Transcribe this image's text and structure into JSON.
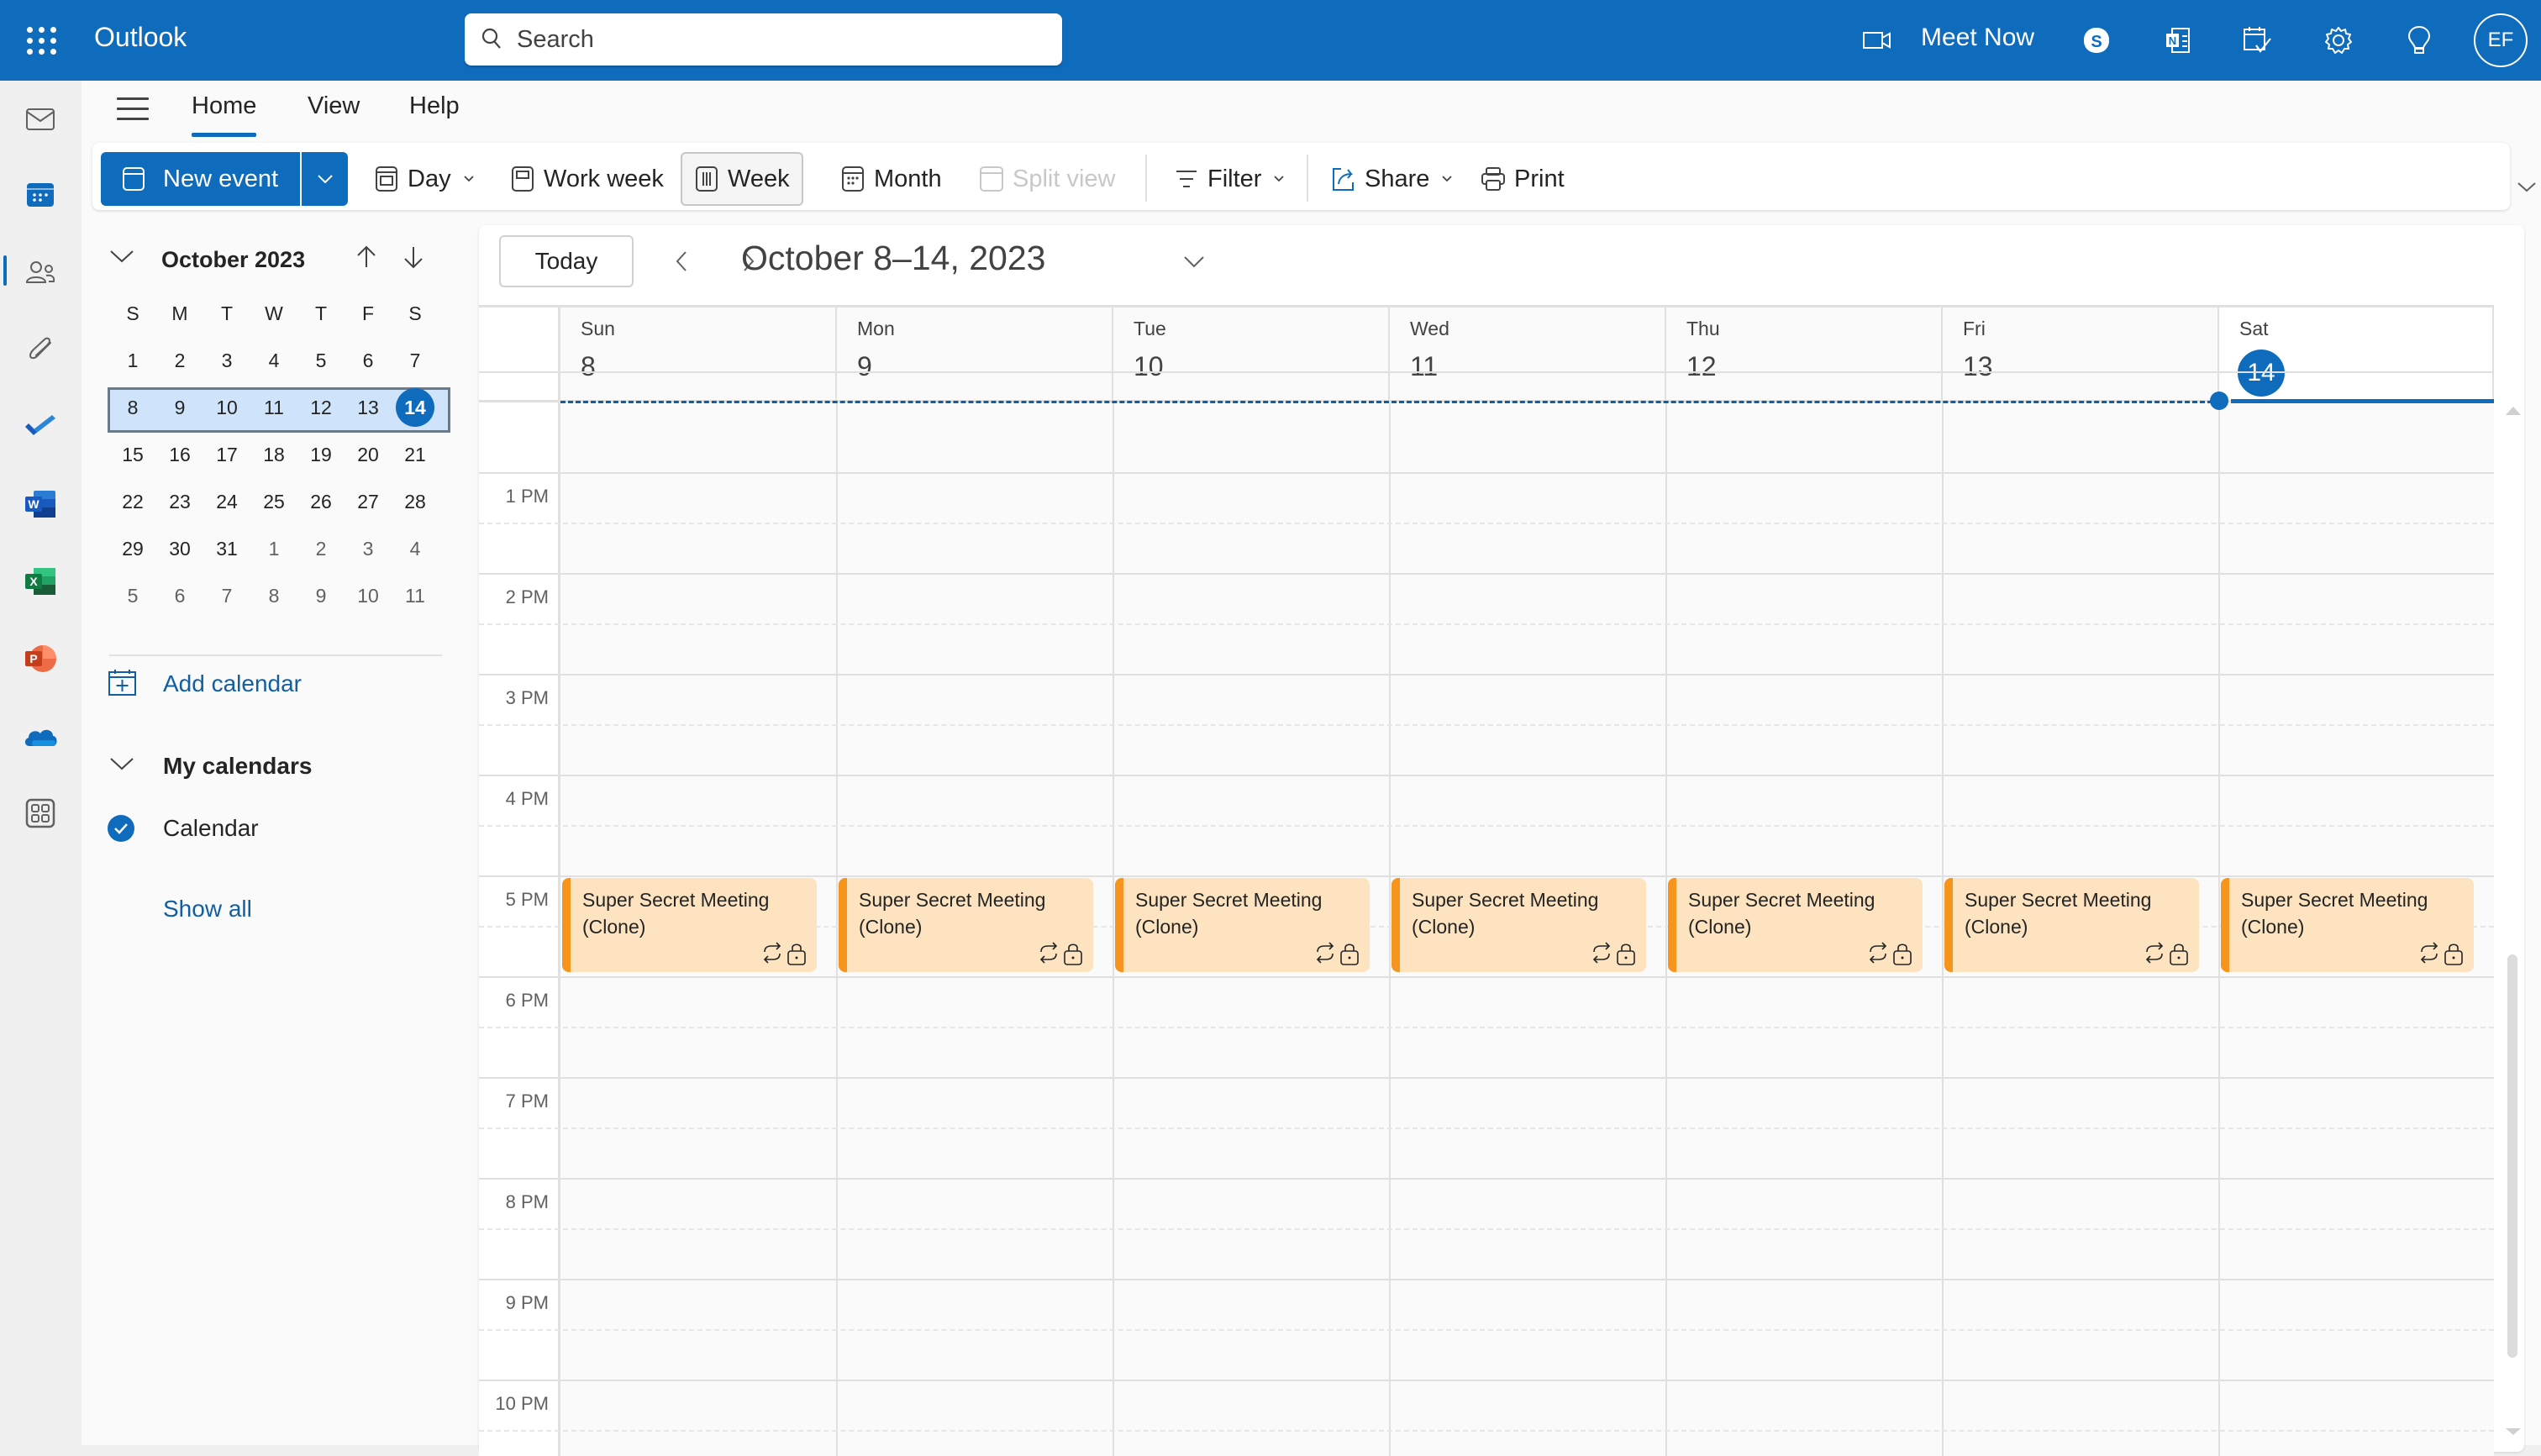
{
  "app": {
    "title": "Outlook",
    "search_placeholder": "Search",
    "meet_now": "Meet Now",
    "avatar_initials": "EF",
    "accent_color": "#0f6cbd"
  },
  "topbar_icons": [
    "video-camera-icon",
    "skype-icon",
    "onenote-icon",
    "my-day-icon",
    "settings-gear-icon",
    "tips-lightbulb-icon"
  ],
  "rail": {
    "items": [
      "mail",
      "calendar",
      "people",
      "files",
      "to-do",
      "word",
      "excel",
      "powerpoint",
      "onedrive",
      "more-apps"
    ],
    "selected": "calendar"
  },
  "tabs": [
    {
      "label": "Home",
      "active": true
    },
    {
      "label": "View",
      "active": false
    },
    {
      "label": "Help",
      "active": false
    }
  ],
  "ribbon": {
    "new_event": "New event",
    "day": "Day",
    "work_week": "Work week",
    "week": "Week",
    "month": "Month",
    "split_view": "Split view",
    "filter": "Filter",
    "share": "Share",
    "print": "Print",
    "selected_view": "Week"
  },
  "mini_calendar": {
    "title": "October 2023",
    "weekday_headers": [
      "S",
      "M",
      "T",
      "W",
      "T",
      "F",
      "S"
    ],
    "weeks": [
      [
        {
          "d": "1"
        },
        {
          "d": "2"
        },
        {
          "d": "3"
        },
        {
          "d": "4"
        },
        {
          "d": "5"
        },
        {
          "d": "6"
        },
        {
          "d": "7"
        }
      ],
      [
        {
          "d": "8"
        },
        {
          "d": "9"
        },
        {
          "d": "10"
        },
        {
          "d": "11"
        },
        {
          "d": "12"
        },
        {
          "d": "13"
        },
        {
          "d": "14",
          "today": true
        }
      ],
      [
        {
          "d": "15"
        },
        {
          "d": "16"
        },
        {
          "d": "17"
        },
        {
          "d": "18"
        },
        {
          "d": "19"
        },
        {
          "d": "20"
        },
        {
          "d": "21"
        }
      ],
      [
        {
          "d": "22"
        },
        {
          "d": "23"
        },
        {
          "d": "24"
        },
        {
          "d": "25"
        },
        {
          "d": "26"
        },
        {
          "d": "27"
        },
        {
          "d": "28"
        }
      ],
      [
        {
          "d": "29"
        },
        {
          "d": "30"
        },
        {
          "d": "31"
        },
        {
          "d": "1",
          "dim": true
        },
        {
          "d": "2",
          "dim": true
        },
        {
          "d": "3",
          "dim": true
        },
        {
          "d": "4",
          "dim": true
        }
      ],
      [
        {
          "d": "5",
          "dim": true
        },
        {
          "d": "6",
          "dim": true
        },
        {
          "d": "7",
          "dim": true
        },
        {
          "d": "8",
          "dim": true
        },
        {
          "d": "9",
          "dim": true
        },
        {
          "d": "10",
          "dim": true
        },
        {
          "d": "11",
          "dim": true
        }
      ]
    ],
    "selected_week_index": 1
  },
  "sidebar": {
    "add_calendar": "Add calendar",
    "my_calendars": "My calendars",
    "calendar_name": "Calendar",
    "calendar_checked": true,
    "show_all": "Show all"
  },
  "calendar_view": {
    "today_button": "Today",
    "range_title": "October 8–14, 2023",
    "days": [
      {
        "name": "Sun",
        "num": "8"
      },
      {
        "name": "Mon",
        "num": "9"
      },
      {
        "name": "Tue",
        "num": "10"
      },
      {
        "name": "Wed",
        "num": "11"
      },
      {
        "name": "Thu",
        "num": "12"
      },
      {
        "name": "Fri",
        "num": "13"
      },
      {
        "name": "Sat",
        "num": "14",
        "today": true
      }
    ],
    "hours": [
      "1 PM",
      "2 PM",
      "3 PM",
      "4 PM",
      "5 PM",
      "6 PM",
      "7 PM",
      "8 PM",
      "9 PM",
      "10 PM"
    ],
    "first_visible_hour": 12.75,
    "events": [
      {
        "day": 0,
        "title": "Super Secret Meeting (Clone)",
        "start": 17,
        "end": 18,
        "recurring": true,
        "private": true
      },
      {
        "day": 1,
        "title": "Super Secret Meeting (Clone)",
        "start": 17,
        "end": 18,
        "recurring": true,
        "private": true
      },
      {
        "day": 2,
        "title": "Super Secret Meeting (Clone)",
        "start": 17,
        "end": 18,
        "recurring": true,
        "private": true
      },
      {
        "day": 3,
        "title": "Super Secret Meeting (Clone)",
        "start": 17,
        "end": 18,
        "recurring": true,
        "private": true
      },
      {
        "day": 4,
        "title": "Super Secret Meeting (Clone)",
        "start": 17,
        "end": 18,
        "recurring": true,
        "private": true
      },
      {
        "day": 5,
        "title": "Super Secret Meeting (Clone)",
        "start": 17,
        "end": 18,
        "recurring": true,
        "private": true
      },
      {
        "day": 6,
        "title": "Super Secret Meeting (Clone)",
        "start": 17,
        "end": 18,
        "recurring": true,
        "private": true
      }
    ],
    "event_color": "#fde3c0",
    "event_accent": "#f7941d"
  }
}
